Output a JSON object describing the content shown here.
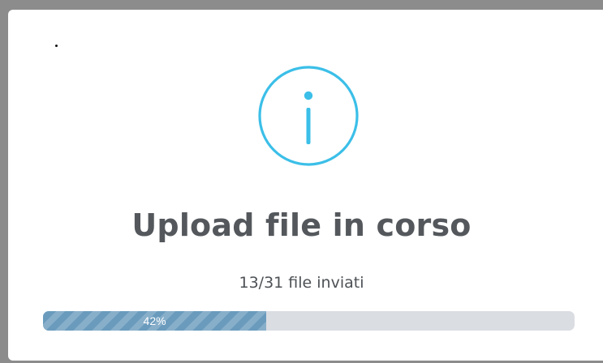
{
  "dialog": {
    "title": "Upload file in corso",
    "status_text": "13/31 file inviati",
    "icon": "info-icon",
    "accent_color": "#3bbfe8",
    "progress": {
      "value_percent": 42,
      "label": "42%",
      "fill_color": "#6a9bbd",
      "track_color": "#dadde2"
    }
  }
}
